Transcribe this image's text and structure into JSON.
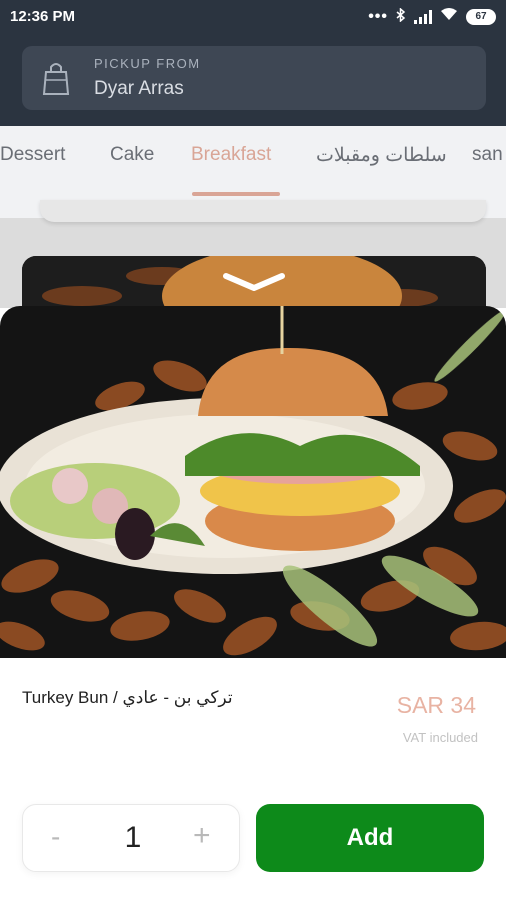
{
  "status_bar": {
    "time": "12:36 PM",
    "battery": "67",
    "icons": [
      "more-dots-icon",
      "bluetooth-icon",
      "signal-icon",
      "wifi-icon",
      "battery-icon"
    ]
  },
  "pickup": {
    "label": "PICKUP FROM",
    "location": "Dyar Arras",
    "icon": "shopping-bag-icon"
  },
  "tabs": [
    {
      "label": "Dessert",
      "active": false
    },
    {
      "label": "Cake",
      "active": false
    },
    {
      "label": "Breakfast",
      "active": true
    },
    {
      "label": "سلطات ومقبلات",
      "active": false
    },
    {
      "label": "san",
      "active": false
    }
  ],
  "product": {
    "name": "Turkey Bun / تركي بن - عادي",
    "price": "SAR 34",
    "vat_note": "VAT included",
    "image": "turkey-bun-photo"
  },
  "quantity": {
    "minus": "-",
    "value": "1",
    "plus": "+"
  },
  "actions": {
    "add_label": "Add"
  },
  "colors": {
    "header_bg": "#2b3440",
    "accent_tab": "#d9a596",
    "price": "#e8b3a3",
    "add_button": "#0d8a1a"
  }
}
